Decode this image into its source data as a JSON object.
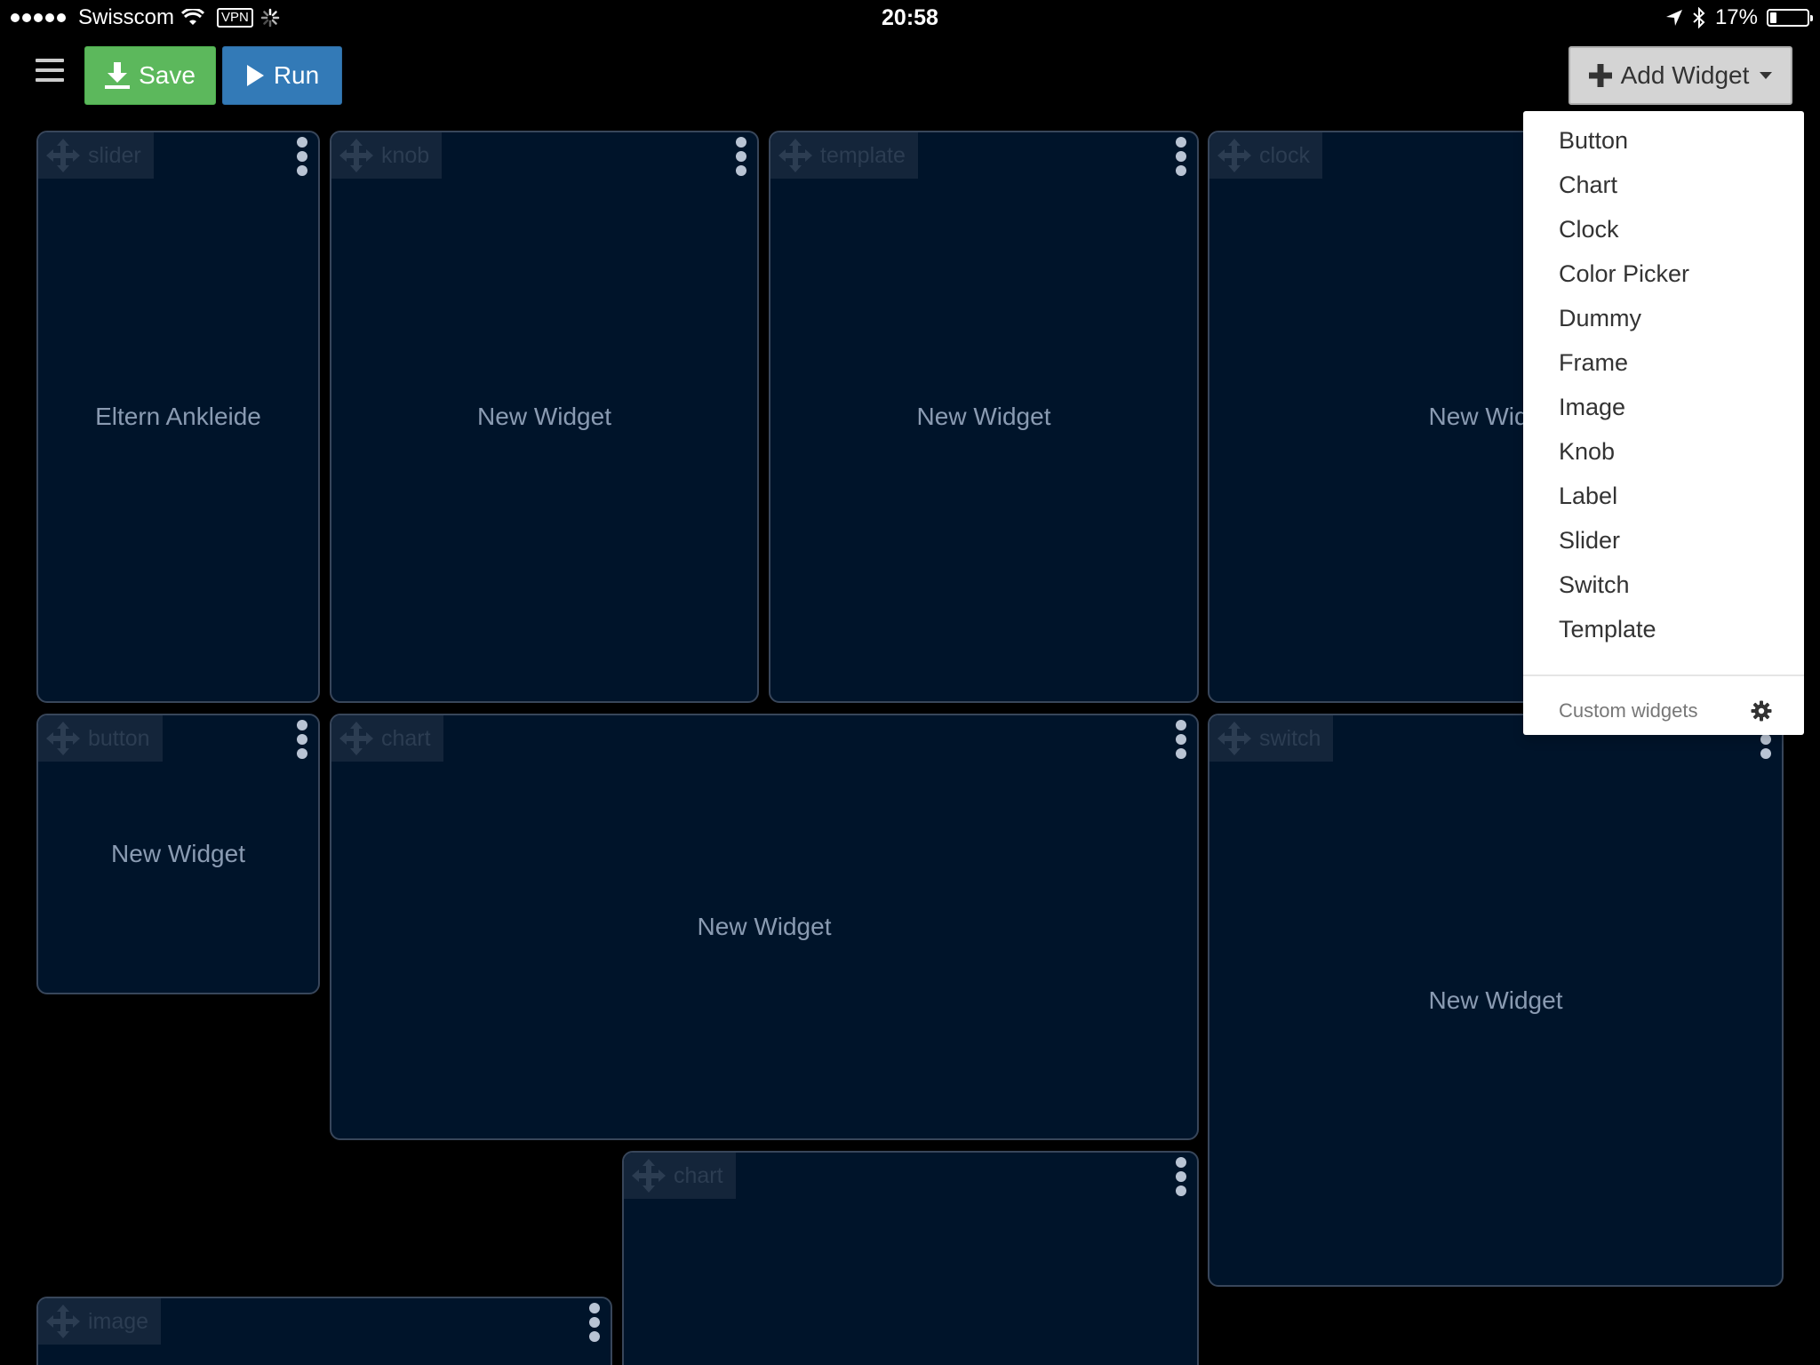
{
  "status_bar": {
    "carrier": "Swisscom",
    "vpn": "VPN",
    "time": "20:58",
    "battery": "17%",
    "battery_level": 0.17
  },
  "toolbar": {
    "save_label": "Save",
    "run_label": "Run",
    "add_widget_label": "Add Widget"
  },
  "colors": {
    "save": "#5cb85c",
    "run": "#337ab7",
    "widget_bg": "#00142a",
    "widget_border": "#38465a"
  },
  "widgets": [
    {
      "type": "slider",
      "text": "Eltern Ankleide"
    },
    {
      "type": "knob",
      "text": "New Widget"
    },
    {
      "type": "template",
      "text": "New Widget"
    },
    {
      "type": "clock",
      "text": "New Widget"
    },
    {
      "type": "button",
      "text": "New Widget"
    },
    {
      "type": "chart",
      "text": "New Widget"
    },
    {
      "type": "switch",
      "text": "New Widget"
    },
    {
      "type": "chart",
      "text": ""
    },
    {
      "type": "image",
      "text": ""
    }
  ],
  "add_widget_menu": {
    "items": [
      "Button",
      "Chart",
      "Clock",
      "Color Picker",
      "Dummy",
      "Frame",
      "Image",
      "Knob",
      "Label",
      "Slider",
      "Switch",
      "Template"
    ],
    "footer_label": "Custom widgets",
    "footer_icon": "gear-icon"
  }
}
